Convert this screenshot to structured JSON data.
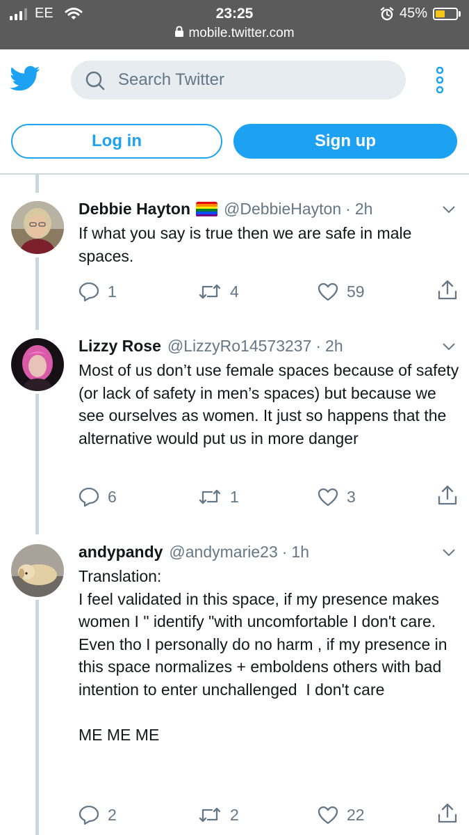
{
  "status_bar": {
    "carrier": "EE",
    "time": "23:25",
    "battery_percent": "45%",
    "battery_level": 0.45,
    "url": "mobile.twitter.com"
  },
  "header": {
    "search_placeholder": "Search Twitter",
    "login_label": "Log in",
    "signup_label": "Sign up",
    "brand_color": "#1da1f2"
  },
  "tweets": [
    {
      "name": "Debbie Hayton",
      "handle": "@DebbieHayton",
      "time": "2h",
      "has_rainbow_flag": true,
      "text": "If what you say is true then we are safe in male spaces.",
      "replies": "1",
      "retweets": "4",
      "likes": "59"
    },
    {
      "name": "Lizzy Rose",
      "handle": "@LizzyRo14573237",
      "time": "2h",
      "text": "Most of us don’t use female spaces because of safety (or lack of safety in men’s spaces) but because we see ourselves as women. It just so happens that the alternative would put us in more danger",
      "replies": "6",
      "retweets": "1",
      "likes": "3"
    },
    {
      "name": "andypandy",
      "handle": "@andymarie23",
      "time": "1h",
      "text": "Translation:\nI feel validated in this space, if my presence makes  women I \" identify \"with uncomfortable I don't care.\nEven tho I personally do no harm , if my presence in this space normalizes + emboldens others with bad intention to enter unchallenged  I don't care\n\nME ME ME",
      "replies": "2",
      "retweets": "2",
      "likes": "22"
    }
  ]
}
